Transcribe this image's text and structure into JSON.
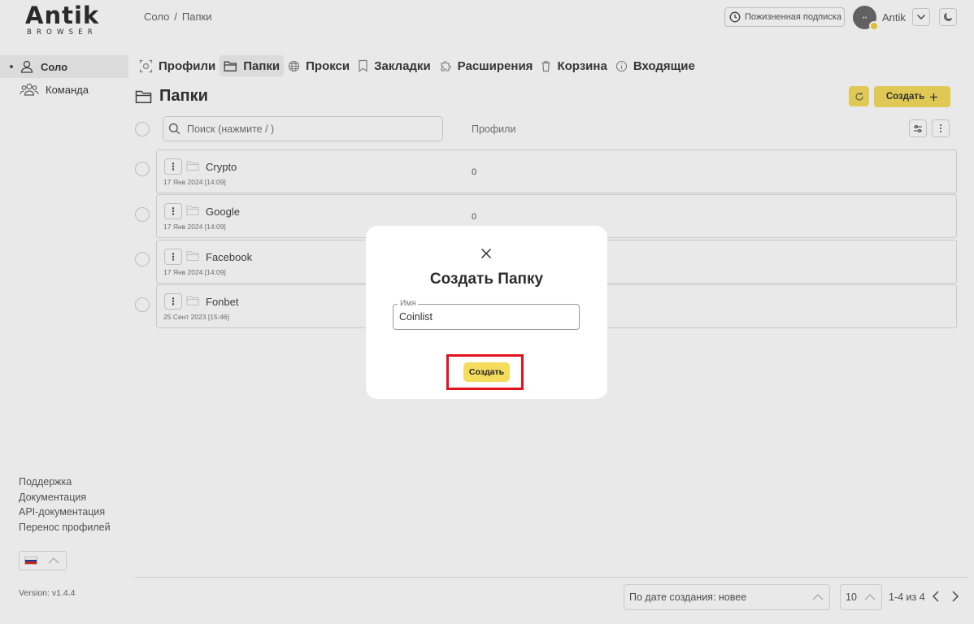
{
  "app": {
    "logo_main": "Antik",
    "logo_sub": "BROWSER",
    "version": "Version: v1.4.4"
  },
  "breadcrumb": [
    "Соло",
    "Папки"
  ],
  "header": {
    "subscription": "Пожизненная подписка",
    "user_name": "Antik"
  },
  "sidebar": {
    "items": [
      {
        "label": "Соло",
        "icon": "user-icon",
        "active": true
      },
      {
        "label": "Команда",
        "icon": "team-icon",
        "active": false
      }
    ],
    "links": [
      "Поддержка",
      "Документация",
      "API-документация",
      "Перенос профилей"
    ]
  },
  "tabs": [
    {
      "label": "Профили",
      "icon": "profile-icon"
    },
    {
      "label": "Папки",
      "icon": "folder-icon",
      "active": true
    },
    {
      "label": "Прокси",
      "icon": "globe-icon"
    },
    {
      "label": "Закладки",
      "icon": "bookmark-icon"
    },
    {
      "label": "Расширения",
      "icon": "puzzle-icon"
    },
    {
      "label": "Корзина",
      "icon": "trash-icon"
    },
    {
      "label": "Входящие",
      "icon": "info-icon"
    }
  ],
  "page": {
    "title": "Папки",
    "create_label": "Создать",
    "search_placeholder": "Поиск (нажмите / )",
    "col_profiles": "Профили"
  },
  "folders": [
    {
      "name": "Crypto",
      "date": "17 Янв 2024 [14:09]",
      "count": "0"
    },
    {
      "name": "Google",
      "date": "17 Янв 2024 [14:09]",
      "count": "0"
    },
    {
      "name": "Facebook",
      "date": "17 Янв 2024 [14:09]",
      "count": ""
    },
    {
      "name": "Fonbet",
      "date": "25 Сент 2023 [15:46]",
      "count": ""
    }
  ],
  "footer": {
    "sort": "По дате создания: новее",
    "per_page": "10",
    "page_info": "1-4 из 4"
  },
  "modal": {
    "title": "Создать Папку",
    "field_label": "Имя",
    "field_value": "Coinlist",
    "submit": "Создать"
  },
  "colors": {
    "accent": "#f4dc5c",
    "highlight": "#e0131e"
  }
}
